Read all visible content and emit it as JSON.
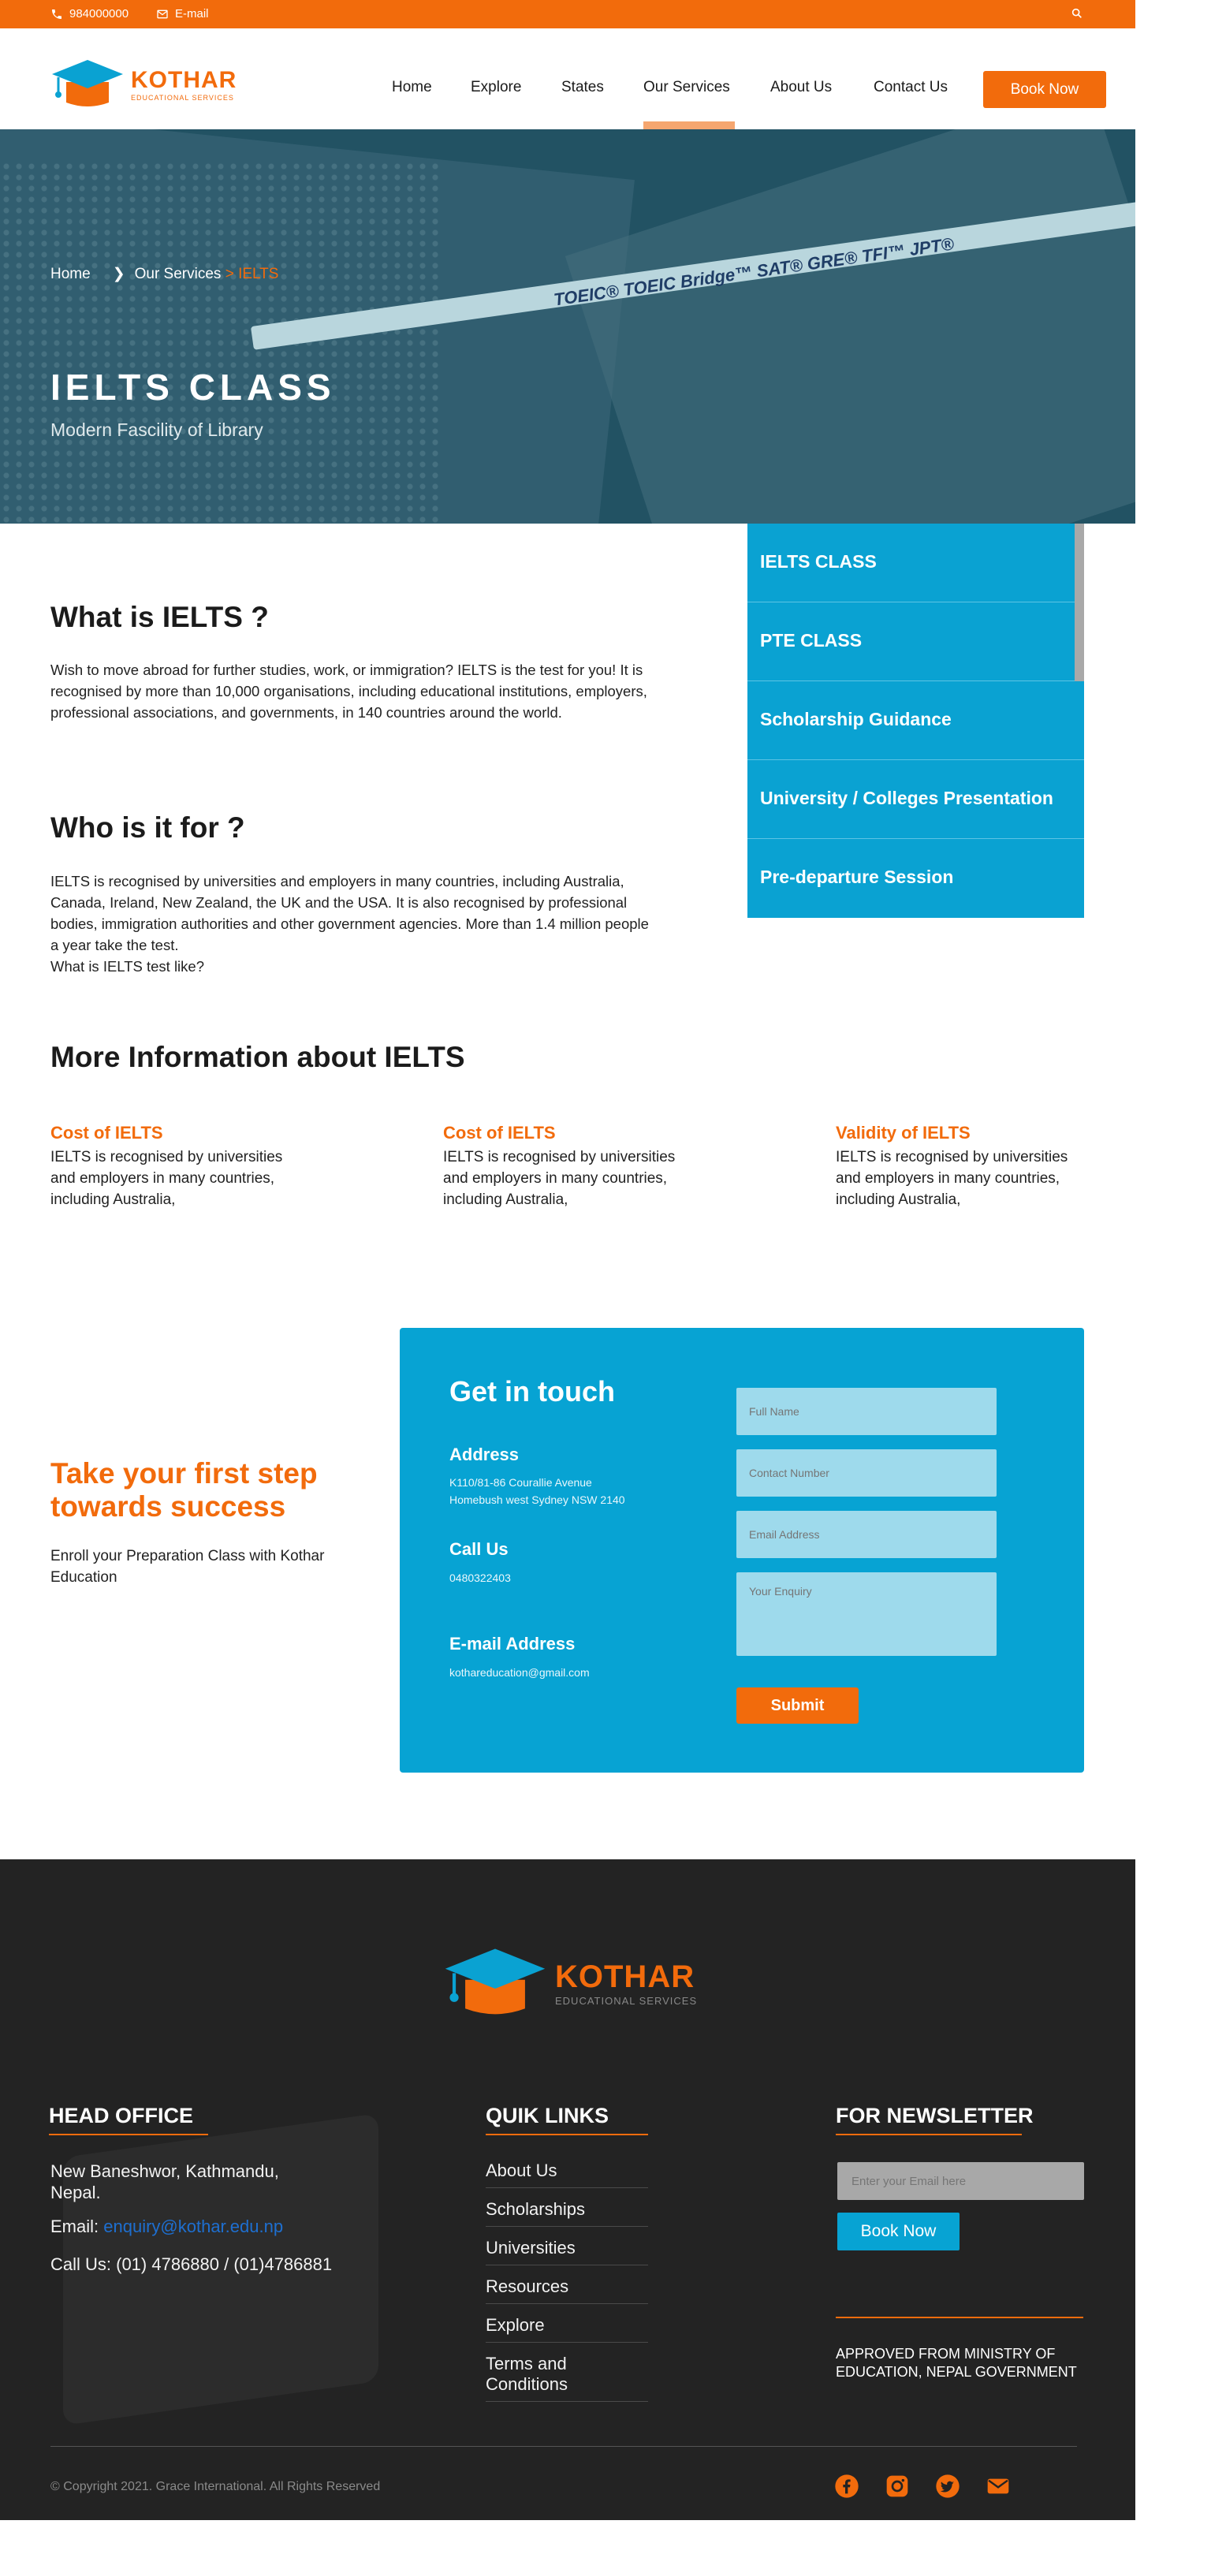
{
  "topbar": {
    "phone": "984000000",
    "email": "E-mail"
  },
  "brand": {
    "name": "KOTHAR",
    "tagline": "EDUCATIONAL SERVICES"
  },
  "nav": {
    "items": [
      "Home",
      "Explore",
      "States",
      "Our Services",
      "About Us",
      "Contact Us"
    ],
    "active": "Our Services",
    "cta": "Book Now"
  },
  "hero": {
    "breadcrumb": {
      "home": "Home",
      "parent": "Our Services",
      "current": "IELTS"
    },
    "title": "IELTS CLASS",
    "subtitle": "Modern Fascility of Library",
    "pen_text": "TOEIC®   TOEIC Bridge™   SAT®   GRE®   TFI™   JPT®"
  },
  "sidebar": {
    "items": [
      "IELTS CLASS",
      "PTE CLASS",
      "Scholarship Guidance",
      "University / Colleges Presentation",
      "Pre-departure Session"
    ]
  },
  "content": {
    "what_title": "What is IELTS ?",
    "what_text": "Wish to move abroad for further studies, work, or immigration? IELTS is the test for you! It is recognised by more than 10,000 organisations, including educational institutions, employers, professional associations, and governments, in 140 countries around the world.",
    "who_title": "Who is it for ?",
    "who_text": "IELTS is recognised by universities and employers in many countries, including Australia, Canada, Ireland, New Zealand, the UK and the USA. It is also recognised by professional bodies, immigration authorities and other government agencies. More than 1.4 million people a year take the test.",
    "who_text2": "What is IELTS test like?",
    "more_title": "More Information about IELTS",
    "info": [
      {
        "title": "Cost of IELTS",
        "text": "IELTS is recognised by universities and employers in many countries, including Australia,"
      },
      {
        "title": "Cost of IELTS",
        "text": "IELTS is recognised by universities and employers in many countries, including Australia,"
      },
      {
        "title": "Validity of IELTS",
        "text": "IELTS is recognised by universities and employers in many countries, including Australia,"
      }
    ]
  },
  "cta": {
    "title": "Take your first step towards success",
    "text": "Enroll your Preparation Class with Kothar Education"
  },
  "contact": {
    "title": "Get in touch",
    "address_label": "Address",
    "address_line1": "K110/81-86 Courallie Avenue",
    "address_line2": "Homebush west Sydney NSW 2140",
    "call_label": "Call Us",
    "call_value": "0480322403",
    "email_label": "E-mail Address",
    "email_value": "kothareducation@gmail.com",
    "placeholders": {
      "name": "Full Name",
      "phone": "Contact Number",
      "email": "Email Address",
      "enquiry": "Your Enquiry"
    },
    "submit": "Submit"
  },
  "footer": {
    "head_office_title": "HEAD OFFICE",
    "address": "New Baneshwor, Kathmandu, Nepal.",
    "email_label": "Email:",
    "email": "enquiry@kothar.edu.np",
    "call": "Call Us: (01) 4786880 / (01)4786881",
    "links_title": "QUIK LINKS",
    "links": [
      "About Us",
      "Scholarships",
      "Universities",
      "Resources",
      "Explore",
      "Terms and Conditions"
    ],
    "newsletter_title": "FOR NEWSLETTER",
    "newsletter_placeholder": "Enter your Email here",
    "newsletter_button": "Book Now",
    "approved": "APPROVED FROM MINISTRY OF EDUCATION, NEPAL GOVERNMENT",
    "copyright": "© Copyright 2021. Grace International. All Rights Reserved",
    "social": [
      "facebook-icon",
      "instagram-icon",
      "twitter-icon",
      "mail-icon"
    ]
  },
  "colors": {
    "accent": "#f26b0c",
    "blue": "#07a3d3",
    "dark": "#232323"
  }
}
